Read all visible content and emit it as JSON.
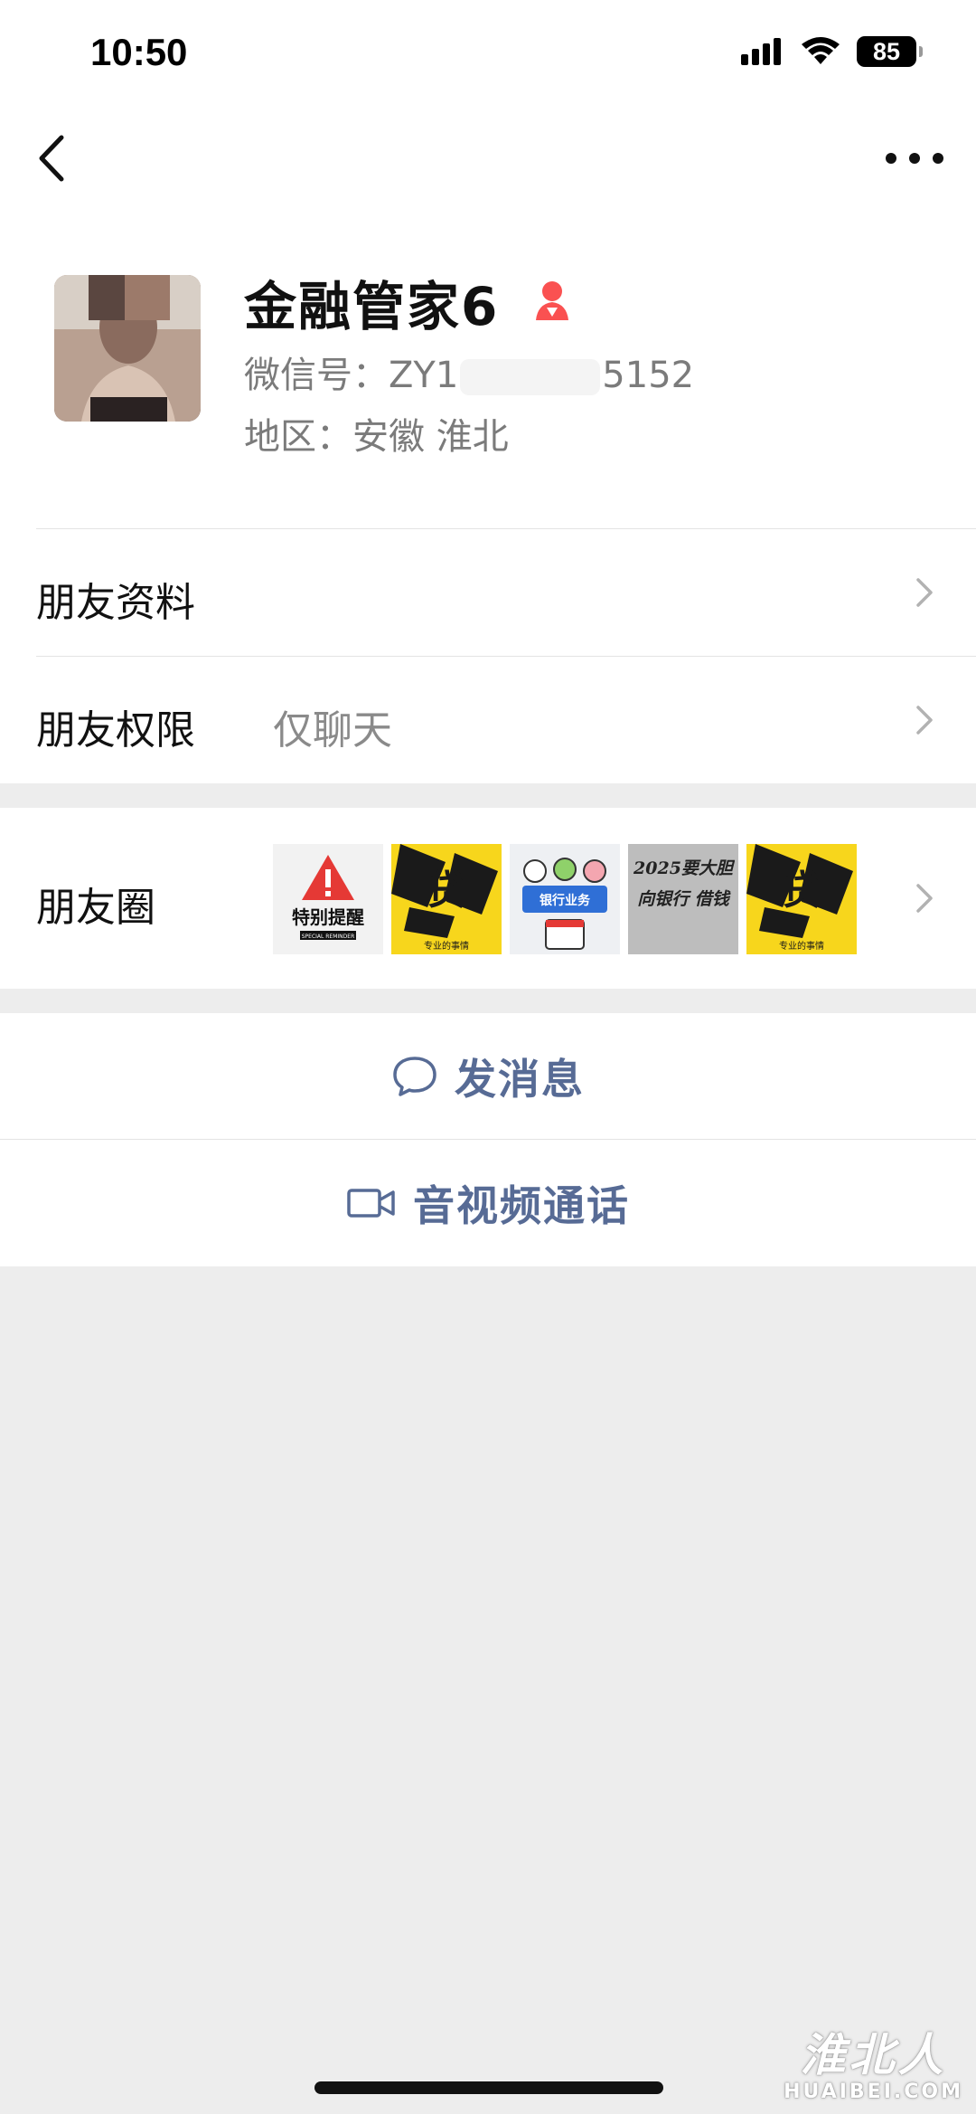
{
  "status_bar": {
    "time": "10:50",
    "battery": "85"
  },
  "nav": {
    "back_icon": "chevron-left-icon",
    "more_icon": "more-dots-icon"
  },
  "profile": {
    "nickname": "金融管家6",
    "wechat_id_prefix": "微信号：ZY1",
    "wechat_id_suffix": "5152",
    "region": "地区：安徽 淮北",
    "gender_icon": "female-icon",
    "gender_color": "#fa5151"
  },
  "rows": {
    "friend_info": {
      "label": "朋友资料"
    },
    "friend_permission": {
      "label": "朋友权限",
      "value": "仅聊天"
    },
    "moments": {
      "label": "朋友圈",
      "thumbs": [
        {
          "text": "特别提醒",
          "sub": "SPECIAL REMINDER"
        },
        {
          "text": "贷",
          "sub": "专业的事情"
        },
        {
          "text": "银行业务",
          "sub": ""
        },
        {
          "text": "2025要大胆 向银行 借钱",
          "sub": ""
        },
        {
          "text": "贷",
          "sub": "专业的事情"
        }
      ]
    }
  },
  "actions": {
    "message": {
      "label": "发消息",
      "icon": "chat-bubble-icon"
    },
    "call": {
      "label": "音视频通话",
      "icon": "video-camera-icon"
    }
  },
  "watermark": {
    "cn": "淮北人",
    "en": "HUAIBEI.COM"
  },
  "colors": {
    "link": "#576b95",
    "bg": "#ededed",
    "card": "#ffffff"
  }
}
